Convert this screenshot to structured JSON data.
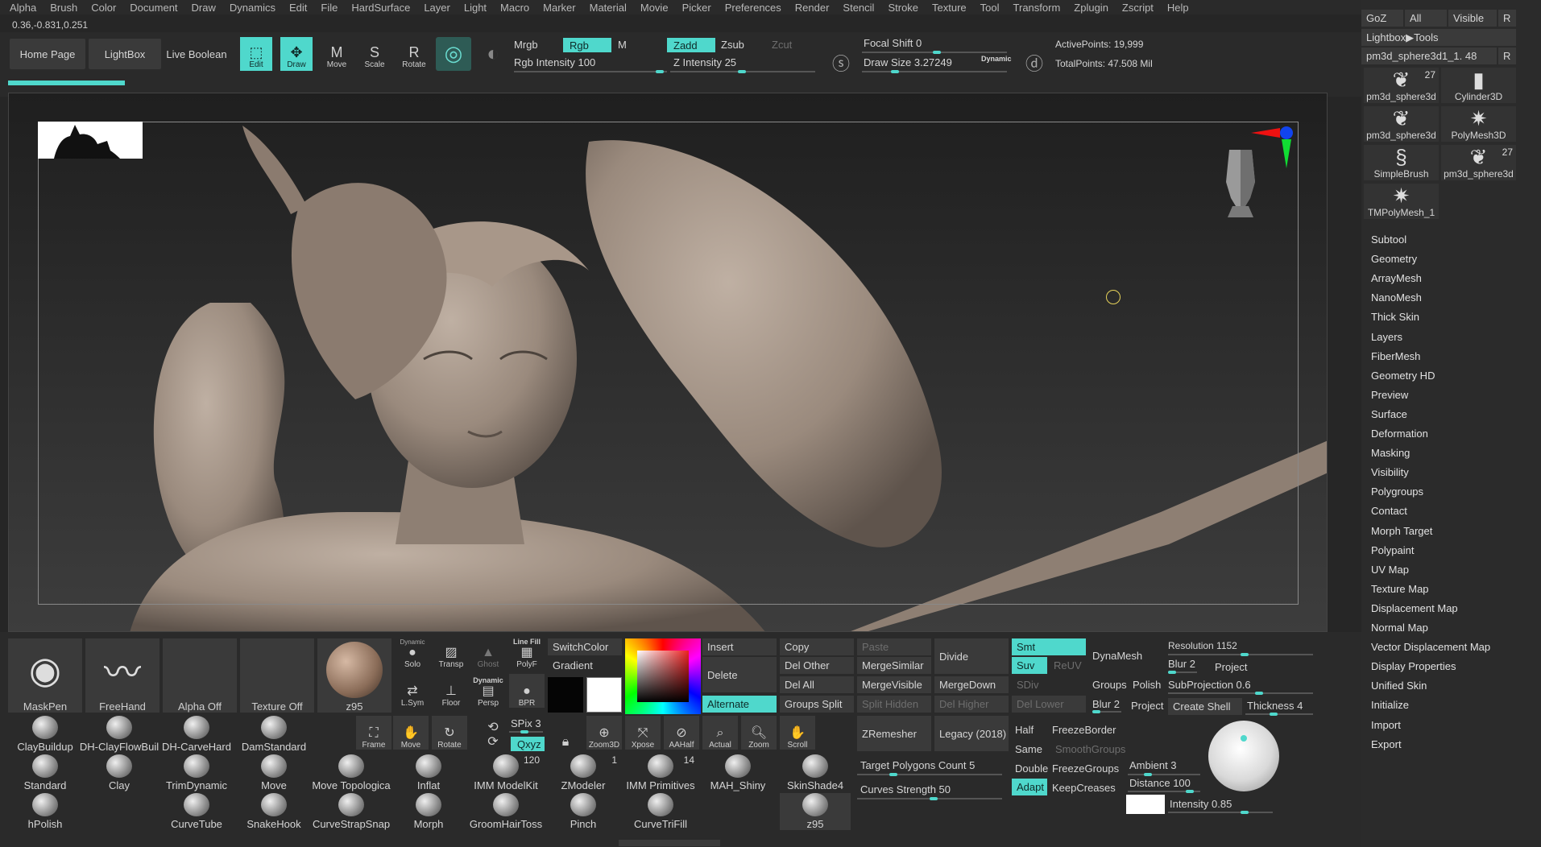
{
  "menu": [
    "Alpha",
    "Brush",
    "Color",
    "Document",
    "Draw",
    "Dynamics",
    "Edit",
    "File",
    "HardSurface",
    "Layer",
    "Light",
    "Macro",
    "Marker",
    "Material",
    "Movie",
    "Picker",
    "Preferences",
    "Render",
    "Stencil",
    "Stroke",
    "Texture",
    "Tool",
    "Transform",
    "Zplugin",
    "Zscript",
    "Help"
  ],
  "coords": "0.36,-0.831,0.251",
  "top": {
    "home_page": "Home Page",
    "lightbox": "LightBox",
    "live_boolean": "Live Boolean",
    "edit": "Edit",
    "draw": "Draw",
    "move": "Move",
    "scale": "Scale",
    "rotate": "Rotate",
    "mrgb": "Mrgb",
    "rgb": "Rgb",
    "m": "M",
    "rgb_intensity": "Rgb Intensity 100",
    "zadd": "Zadd",
    "zsub": "Zsub",
    "zcut": "Zcut",
    "z_intensity": "Z Intensity 25",
    "focal_shift": "Focal Shift 0",
    "draw_size": "Draw Size 3.27249",
    "dynamic": "Dynamic",
    "active_points": "ActivePoints: 19,999",
    "total_points": "TotalPoints: 47.508 Mil"
  },
  "right": {
    "goz": "GoZ",
    "all": "All",
    "visible": "Visible",
    "r": "R",
    "lightbox_tools": "Lightbox▶Tools",
    "current_tool": "pm3d_sphere3d1_1. 48",
    "tools": [
      {
        "name": "pm3d_sphere3d",
        "count": "27"
      },
      {
        "name": "Cylinder3D",
        "count": ""
      },
      {
        "name": "pm3d_sphere3d",
        "count": ""
      },
      {
        "name": "PolyMesh3D",
        "count": ""
      },
      {
        "name": "SimpleBrush",
        "count": ""
      },
      {
        "name": "pm3d_sphere3d",
        "count": "27"
      },
      {
        "name": "TMPolyMesh_1",
        "count": ""
      }
    ],
    "subpalettes": [
      "Subtool",
      "Geometry",
      "ArrayMesh",
      "NanoMesh",
      "Thick Skin",
      "Layers",
      "FiberMesh",
      "Geometry HD",
      "Preview",
      "Surface",
      "Deformation",
      "Masking",
      "Visibility",
      "Polygroups",
      "Contact",
      "Morph Target",
      "Polypaint",
      "UV Map",
      "Texture Map",
      "Displacement Map",
      "Normal Map",
      "Vector Displacement Map",
      "Display Properties",
      "Unified Skin",
      "Initialize",
      "Import",
      "Export"
    ]
  },
  "bottom": {
    "maskpen": "MaskPen",
    "freehand": "FreeHand",
    "alpha_off": "Alpha Off",
    "texture_off": "Texture Off",
    "z95": "z95",
    "solo": "Solo",
    "dynamic_small": "Dynamic",
    "transp": "Transp",
    "ghost": "Ghost",
    "line_fill": "Line Fill",
    "polyf": "PolyF",
    "lsym": "L.Sym",
    "floor": "Floor",
    "persp": "Persp",
    "bpr": "BPR",
    "switchcolor": "SwitchColor",
    "gradient": "Gradient",
    "spix": "SPix 3",
    "qxyz": "Qxyz",
    "frame": "Frame",
    "move": "Move",
    "rotate": "Rotate",
    "zoom3d": "Zoom3D",
    "xpose": "Xpose",
    "aahalf": "AAHalf",
    "actual": "Actual",
    "zoom": "Zoom",
    "scroll": "Scroll",
    "insert": "Insert",
    "delete": "Delete",
    "alternate": "Alternate",
    "copy": "Copy",
    "del_other": "Del Other",
    "del_all": "Del All",
    "groups_split": "Groups Split",
    "paste": "Paste",
    "merge_similar": "MergeSimilar",
    "merge_visible": "MergeVisible",
    "split_hidden": "Split Hidden",
    "divide": "Divide",
    "merge_down": "MergeDown",
    "del_higher": "Del Higher",
    "smt": "Smt",
    "suv": "Suv",
    "reuv": "ReUV",
    "sdiv": "SDiv",
    "del_lower": "Del Lower",
    "dynamesh": "DynaMesh",
    "groups": "Groups",
    "polish": "Polish",
    "blur": "Blur 2",
    "project": "Project",
    "resolution": "Resolution 1152",
    "blur2": "Blur 2",
    "project2": "Project",
    "subprojection": "SubProjection 0.6",
    "create_shell": "Create Shell",
    "thickness": "Thickness 4",
    "zremesher": "ZRemesher",
    "legacy": "Legacy (2018)",
    "half": "Half",
    "same": "Same",
    "double": "Double",
    "adapt": "Adapt",
    "freeze_border": "FreezeBorder",
    "smooth_groups": "SmoothGroups",
    "freeze_groups": "FreezeGroups",
    "keep_creases": "KeepCreases",
    "target_polygons": "Target Polygons Count 5",
    "curves_strength": "Curves Strength 50",
    "ambient": "Ambient 3",
    "distance": "Distance 100",
    "intensity": "Intensity 0.85",
    "brushes": [
      {
        "name": "ClayBuildup",
        "count": ""
      },
      {
        "name": "DH-ClayFlowBuil",
        "count": ""
      },
      {
        "name": "DH-CarveHard",
        "count": ""
      },
      {
        "name": "DamStandard",
        "count": ""
      },
      {
        "name": "Standard",
        "count": ""
      },
      {
        "name": "Clay",
        "count": ""
      },
      {
        "name": "TrimDynamic",
        "count": ""
      },
      {
        "name": "Move",
        "count": ""
      },
      {
        "name": "Move Topologica",
        "count": ""
      },
      {
        "name": "Inflat",
        "count": ""
      },
      {
        "name": "IMM ModelKit",
        "count": "120"
      },
      {
        "name": "ZModeler",
        "count": "1"
      },
      {
        "name": "IMM Primitives",
        "count": "14"
      },
      {
        "name": "MAH_Shiny",
        "count": ""
      },
      {
        "name": "SkinShade4",
        "count": ""
      },
      {
        "name": "hPolish",
        "count": ""
      },
      {
        "name": "CurveTube",
        "count": ""
      },
      {
        "name": "SnakeHook",
        "count": ""
      },
      {
        "name": "CurveStrapSnap",
        "count": ""
      },
      {
        "name": "Morph",
        "count": ""
      },
      {
        "name": "GroomHairToss",
        "count": ""
      },
      {
        "name": "Pinch",
        "count": ""
      },
      {
        "name": "CurveTriFill",
        "count": ""
      },
      {
        "name": "z95",
        "count": ""
      }
    ]
  }
}
